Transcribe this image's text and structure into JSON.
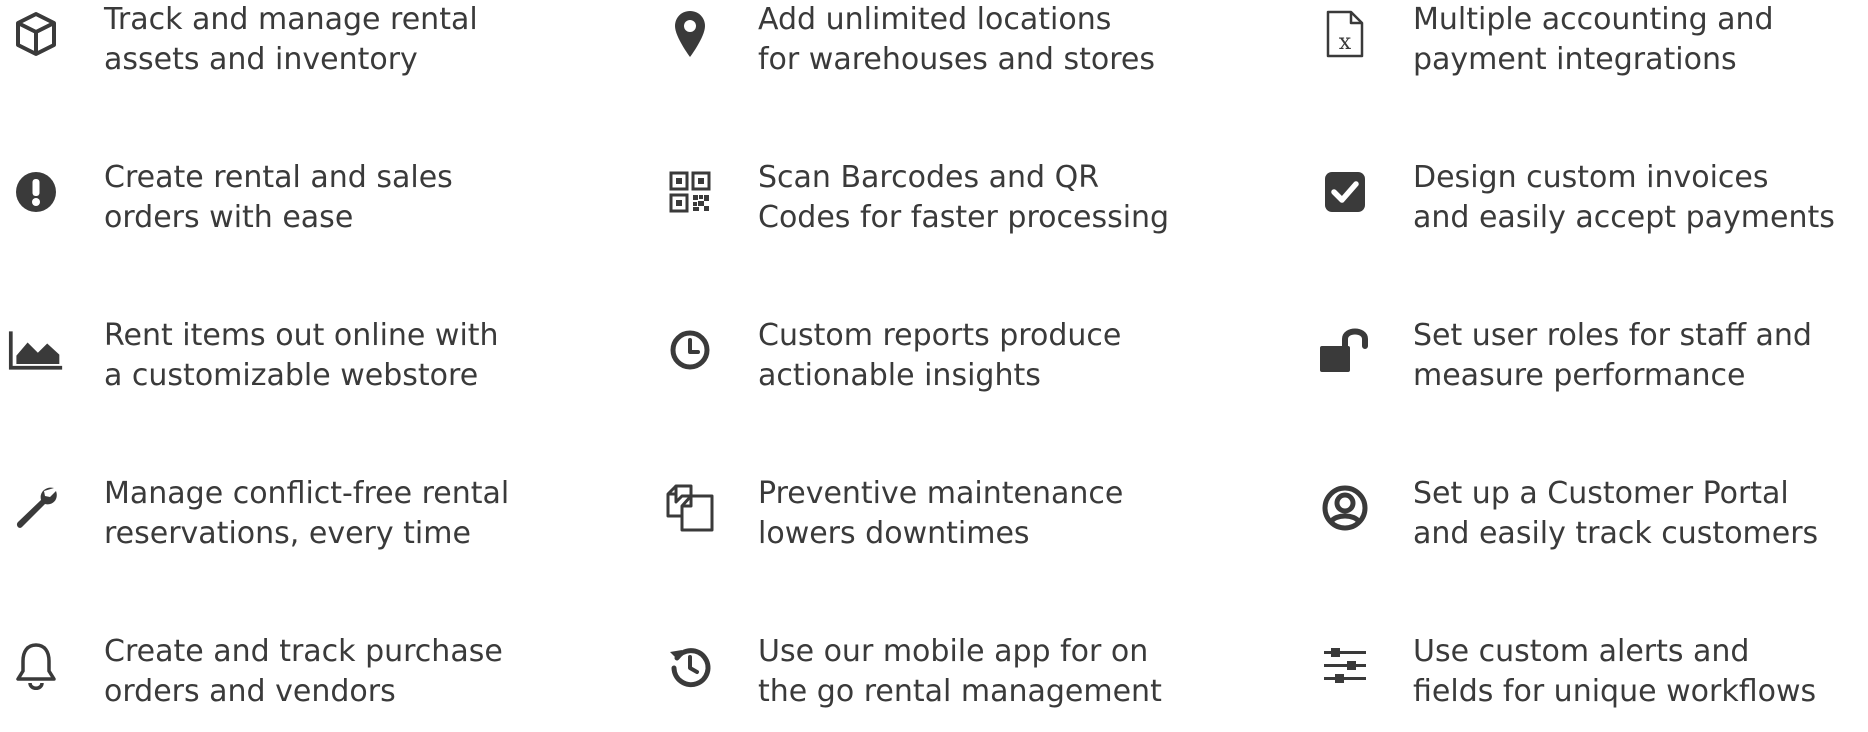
{
  "colors": {
    "text": "#3a3a3a",
    "icon": "#3a3a3a",
    "background": "#ffffff"
  },
  "columns": [
    {
      "features": [
        {
          "icon": "box-icon",
          "line1": "Track and manage rental",
          "line2": "assets and inventory"
        },
        {
          "icon": "exclamation-circle-icon",
          "line1": "Create rental and sales",
          "line2": "orders with ease"
        },
        {
          "icon": "area-chart-icon",
          "line1": "Rent items out online with",
          "line2": "a customizable webstore"
        },
        {
          "icon": "wrench-icon",
          "line1": "Manage conflict-free rental",
          "line2": "reservations, every time"
        },
        {
          "icon": "bell-icon",
          "line1": "Create and track purchase",
          "line2": "orders and vendors"
        }
      ]
    },
    {
      "features": [
        {
          "icon": "map-marker-icon",
          "line1": "Add unlimited locations",
          "line2": "for warehouses and stores"
        },
        {
          "icon": "qr-code-icon",
          "line1": "Scan Barcodes and QR",
          "line2": "Codes for faster processing"
        },
        {
          "icon": "clock-icon",
          "line1": "Custom reports produce",
          "line2": "actionable insights"
        },
        {
          "icon": "copy-documents-icon",
          "line1": "Preventive maintenance",
          "line2": "lowers downtimes"
        },
        {
          "icon": "history-icon",
          "line1": "Use our mobile app for on",
          "line2": "the go rental management"
        }
      ]
    },
    {
      "features": [
        {
          "icon": "spreadsheet-file-icon",
          "line1": "Multiple accounting and",
          "line2": "payment integrations"
        },
        {
          "icon": "check-square-icon",
          "line1": "Design custom invoices",
          "line2": "and easily accept payments"
        },
        {
          "icon": "unlock-icon",
          "line1": "Set user roles for staff and",
          "line2": "measure performance"
        },
        {
          "icon": "user-circle-icon",
          "line1": "Set up a Customer Portal",
          "line2": "and easily track customers"
        },
        {
          "icon": "sliders-icon",
          "line1": "Use custom alerts and",
          "line2": "fields for unique workflows"
        }
      ]
    }
  ]
}
